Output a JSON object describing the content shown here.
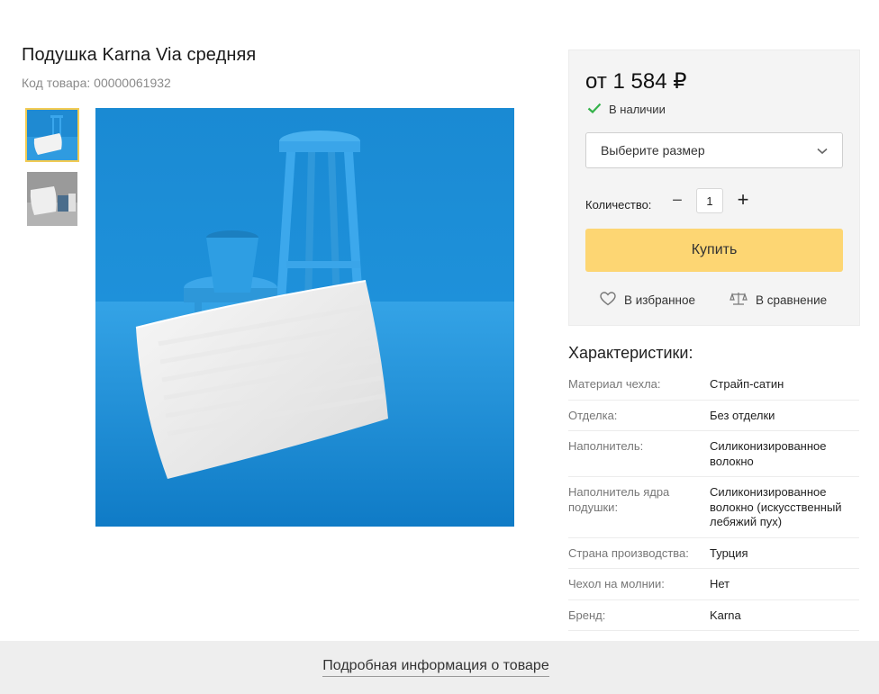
{
  "product": {
    "title": "Подушка Karna Via средняя",
    "sku": "Код товара: 00000061932"
  },
  "gallery": {
    "thumbnails": [
      {
        "name": "thumbnail-blue-scene",
        "active": true
      },
      {
        "name": "thumbnail-grey-scene",
        "active": false
      }
    ],
    "main_image": "pillow-blue-scene-image"
  },
  "buy_box": {
    "price": "от 1 584 ₽",
    "stock": "В наличии",
    "size_placeholder": "Выберите размер",
    "quantity_label": "Количество:",
    "quantity_value": "1",
    "minus": "−",
    "plus": "+",
    "buy_label": "Купить",
    "favorite_label": "В избранное",
    "compare_label": "В сравнение"
  },
  "characteristics": {
    "title": "Характеристики:",
    "rows": [
      {
        "key": "Материал чехла:",
        "value": "Страйп-сатин"
      },
      {
        "key": "Отделка:",
        "value": "Без отделки"
      },
      {
        "key": "Наполнитель:",
        "value": "Силиконизированное волокно"
      },
      {
        "key": "Наполнитель ядра подушки:",
        "value": "Силиконизированное волокно (искусственный лебяжий пух)"
      },
      {
        "key": "Страна производства:",
        "value": "Турция"
      },
      {
        "key": "Чехол на молнии:",
        "value": "Нет"
      },
      {
        "key": "Бренд:",
        "value": "Karna"
      }
    ]
  },
  "footer": {
    "more_info_link": "Подробная информация о товаре"
  },
  "colors": {
    "accent": "#fdd673",
    "thumb_border": "#f2cb52",
    "stock_check": "#34b24a",
    "image_bg": "#1a8fd6"
  },
  "icons": [
    "check-icon",
    "chevron-down-icon",
    "heart-icon",
    "scales-icon"
  ]
}
